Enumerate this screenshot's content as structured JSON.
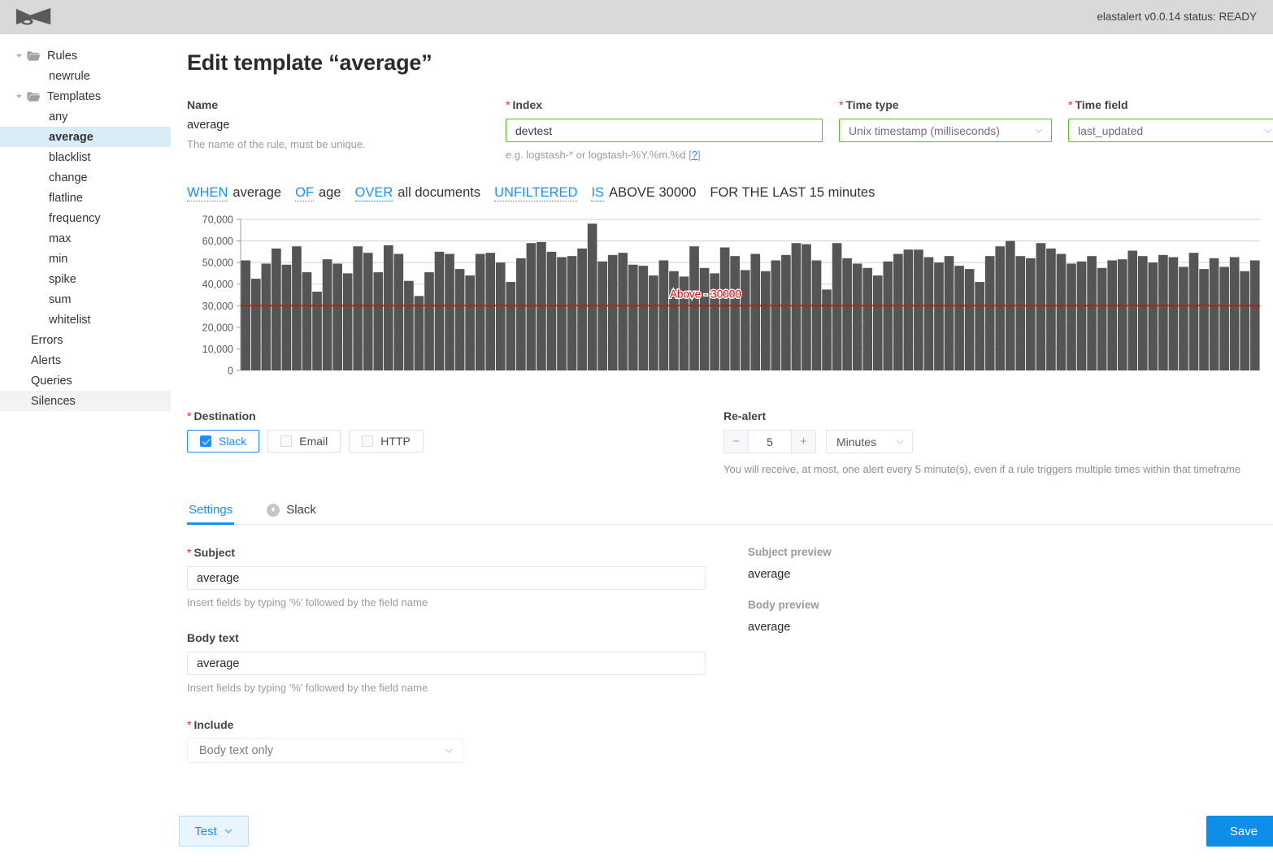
{
  "header": {
    "logo_icon": "megaphone-icon",
    "status": "elastalert v0.0.14 status: READY"
  },
  "sidebar": {
    "items": [
      {
        "label": "Rules",
        "level": 0,
        "type": "folder",
        "expanded": true,
        "selected": false
      },
      {
        "label": "newrule",
        "level": 1,
        "type": "leaf",
        "selected": false
      },
      {
        "label": "Templates",
        "level": 0,
        "type": "folder",
        "expanded": true,
        "selected": false
      },
      {
        "label": "any",
        "level": 1,
        "type": "leaf",
        "selected": false
      },
      {
        "label": "average",
        "level": 1,
        "type": "leaf",
        "selected": true
      },
      {
        "label": "blacklist",
        "level": 1,
        "type": "leaf",
        "selected": false
      },
      {
        "label": "change",
        "level": 1,
        "type": "leaf",
        "selected": false
      },
      {
        "label": "flatline",
        "level": 1,
        "type": "leaf",
        "selected": false
      },
      {
        "label": "frequency",
        "level": 1,
        "type": "leaf",
        "selected": false
      },
      {
        "label": "max",
        "level": 1,
        "type": "leaf",
        "selected": false
      },
      {
        "label": "min",
        "level": 1,
        "type": "leaf",
        "selected": false
      },
      {
        "label": "spike",
        "level": 1,
        "type": "leaf",
        "selected": false
      },
      {
        "label": "sum",
        "level": 1,
        "type": "leaf",
        "selected": false
      },
      {
        "label": "whitelist",
        "level": 1,
        "type": "leaf",
        "selected": false
      },
      {
        "label": "Errors",
        "level": 0,
        "type": "plain",
        "selected": false
      },
      {
        "label": "Alerts",
        "level": 0,
        "type": "plain",
        "selected": false
      },
      {
        "label": "Queries",
        "level": 0,
        "type": "plain",
        "selected": false
      },
      {
        "label": "Silences",
        "level": 0,
        "type": "plain",
        "selected": false,
        "hover": true
      }
    ]
  },
  "page": {
    "title": "Edit template “average”"
  },
  "form": {
    "name": {
      "label": "Name",
      "value": "average",
      "help": "The name of the rule, must be unique."
    },
    "index": {
      "label": "Index",
      "required": true,
      "value": "devtest",
      "help_prefix": "e.g. logstash-* or logstash-%Y.%m.%d [",
      "help_link": "?",
      "help_suffix": "]"
    },
    "time_type": {
      "label": "Time type",
      "required": true,
      "value": "Unix timestamp (milliseconds)"
    },
    "time_field": {
      "label": "Time field",
      "required": true,
      "value": "last_updated"
    }
  },
  "query": {
    "segments": [
      {
        "key": "WHEN",
        "value": "average"
      },
      {
        "key": "OF",
        "value": "age"
      },
      {
        "key": "OVER",
        "value": "all documents"
      },
      {
        "key": "UNFILTERED",
        "value": ""
      },
      {
        "key": "IS",
        "value": "ABOVE 30000"
      }
    ],
    "trailing": "FOR THE LAST 15 minutes"
  },
  "chart_data": {
    "type": "bar",
    "title": "",
    "xlabel": "",
    "ylabel": "",
    "ylim": [
      0,
      70000
    ],
    "grid": true,
    "legend": false,
    "ytick_labels": [
      "70,000",
      "60,000",
      "50,000",
      "40,000",
      "30,000",
      "20,000",
      "10,000",
      "0"
    ],
    "yticks": [
      70000,
      60000,
      50000,
      40000,
      30000,
      20000,
      10000,
      0
    ],
    "bar_color": "#555555",
    "threshold": {
      "value": 30000,
      "label": "Above - 30000",
      "color": "#f40000",
      "label_color": "#f40000",
      "label_outline": "#ffffff"
    },
    "values": [
      51000,
      42500,
      49500,
      56500,
      49000,
      57500,
      45500,
      36500,
      51500,
      49500,
      45000,
      57500,
      54500,
      45500,
      58000,
      54000,
      41500,
      34500,
      45500,
      55000,
      54000,
      47000,
      44000,
      54000,
      54500,
      50000,
      41000,
      52000,
      59000,
      59500,
      55000,
      52500,
      53000,
      56500,
      68000,
      50500,
      53500,
      54500,
      49000,
      48500,
      44000,
      51000,
      46000,
      43500,
      57500,
      47500,
      45000,
      57000,
      53000,
      46500,
      54000,
      46000,
      51000,
      53500,
      59000,
      58500,
      51000,
      37500,
      59000,
      52000,
      49500,
      47500,
      44000,
      50500,
      54000,
      56000,
      56000,
      52500,
      50000,
      53000,
      48500,
      47000,
      41000,
      53000,
      57500,
      60000,
      53000,
      52000,
      59000,
      56500,
      54000,
      49500,
      50500,
      53000,
      47500,
      51000,
      51500,
      55500,
      53000,
      50000,
      53500,
      52500,
      48000,
      54500,
      47000,
      52000,
      48000,
      52500,
      46000,
      51000
    ]
  },
  "destination": {
    "label": "Destination",
    "required": true,
    "options": [
      {
        "label": "Slack",
        "checked": true
      },
      {
        "label": "Email",
        "checked": false
      },
      {
        "label": "HTTP",
        "checked": false
      }
    ]
  },
  "realert": {
    "label": "Re-alert",
    "decrement": "−",
    "increment": "+",
    "value": "5",
    "unit": "Minutes",
    "note": "You will receive, at most, one alert every 5 minute(s), even if a rule triggers multiple times within that timeframe"
  },
  "tabs": [
    {
      "label": "Settings",
      "active": true,
      "icon": ""
    },
    {
      "label": "Slack",
      "active": false,
      "icon": "slack-icon"
    }
  ],
  "settings": {
    "subject": {
      "label": "Subject",
      "required": true,
      "value": "average",
      "help": "Insert fields by typing '%' followed by the field name"
    },
    "body": {
      "label": "Body text",
      "required": false,
      "value": "average",
      "help": "Insert fields by typing '%' followed by the field name"
    },
    "include": {
      "label": "Include",
      "required": true,
      "value": "Body text only"
    },
    "preview": {
      "subject_label": "Subject preview",
      "subject_value": "average",
      "body_label": "Body preview",
      "body_value": "average"
    }
  },
  "footer": {
    "test_label": "Test",
    "save_label": "Save"
  },
  "colors": {
    "accent": "#1890ff",
    "save_button": "#0f8ee9",
    "required_star": "#f5222d",
    "valid_border": "#52c41a",
    "bar": "#555555",
    "threshold": "#f40000",
    "selected_nav": "#d9edf9"
  }
}
